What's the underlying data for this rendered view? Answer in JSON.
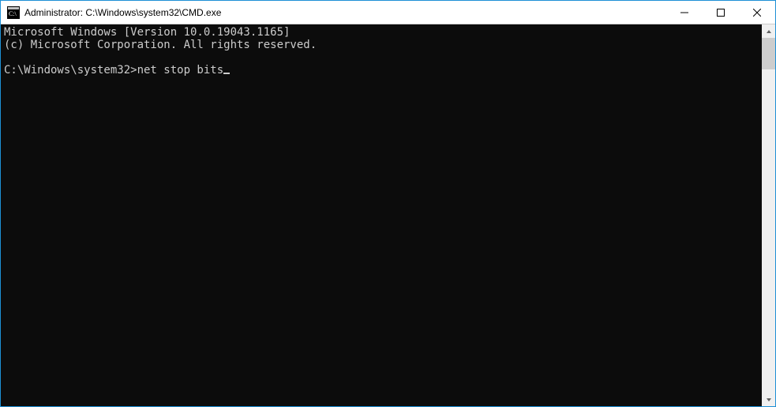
{
  "titlebar": {
    "title": "Administrator: C:\\Windows\\system32\\CMD.exe"
  },
  "console": {
    "line1": "Microsoft Windows [Version 10.0.19043.1165]",
    "line2": "(c) Microsoft Corporation. All rights reserved.",
    "blank": "",
    "prompt": "C:\\Windows\\system32>",
    "command": "net stop bits"
  }
}
